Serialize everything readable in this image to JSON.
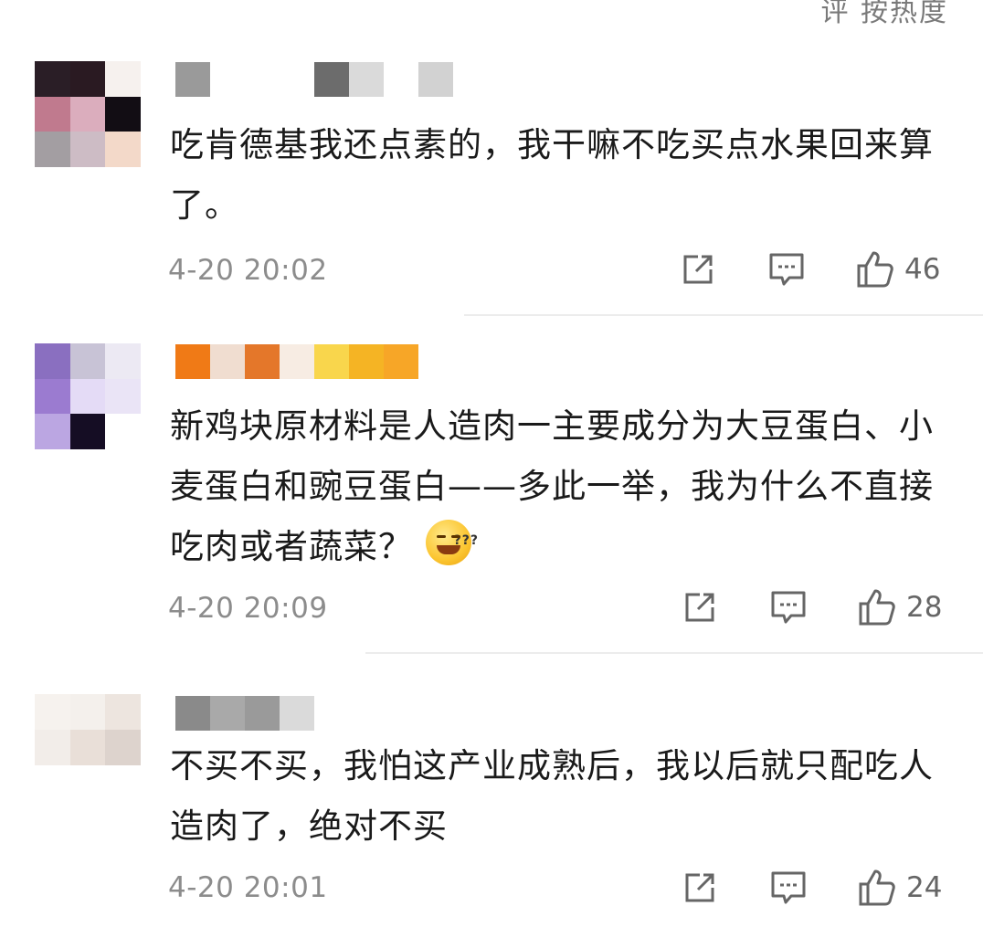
{
  "header": {
    "partial_text": "评 按热度"
  },
  "comments": [
    {
      "text": "吃肯德基我还点素的，我干嘛不吃买点水果回来算了。",
      "timestamp": "4-20 20:02",
      "likes": "46",
      "has_emoji": false
    },
    {
      "text": "新鸡块原材料是人造肉一主要成分为大豆蛋白、小麦蛋白和豌豆蛋白——多此一举，我为什么不直接吃肉或者蔬菜？",
      "timestamp": "4-20 20:09",
      "likes": "28",
      "has_emoji": true,
      "emoji_name": "confused-face-emoji"
    },
    {
      "text": "不买不买，我怕这产业成熟后，我以后就只配吃人造肉了，绝对不买",
      "timestamp": "4-20 20:01",
      "likes": "24",
      "has_emoji": false
    }
  ],
  "icons": {
    "share": "share-icon",
    "comment": "comment-icon",
    "like": "thumbs-up-icon"
  },
  "colors": {
    "text": "#1a1a1a",
    "meta": "#8c8c8c",
    "icon": "#666666",
    "divider": "#ececec"
  }
}
